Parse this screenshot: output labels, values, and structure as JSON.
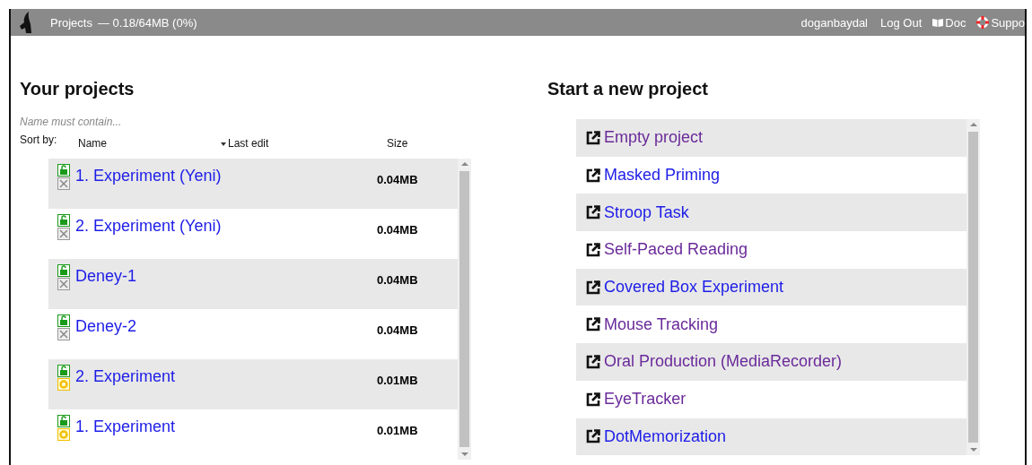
{
  "header": {
    "title": "Projects",
    "usage": "— 0.18/64MB (0%)",
    "user": "doganbaydal",
    "logout": "Log Out",
    "doc": "Doc",
    "support": "Suppo"
  },
  "projects": {
    "heading": "Your projects",
    "filter": {
      "placeholder": "Name must contain..."
    },
    "sort": {
      "label": "Sort by:",
      "columns": [
        {
          "label": "Name",
          "selected": false
        },
        {
          "label": "Last edit",
          "selected": true
        },
        {
          "label": "Size",
          "selected": false
        }
      ]
    },
    "rows": [
      {
        "name": "1. Experiment (Yeni)",
        "size": "0.04MB",
        "kind": "tools"
      },
      {
        "name": "2. Experiment (Yeni)",
        "size": "0.04MB",
        "kind": "tools"
      },
      {
        "name": "Deney-1",
        "size": "0.04MB",
        "kind": "tools"
      },
      {
        "name": "Deney-2",
        "size": "0.04MB",
        "kind": "tools"
      },
      {
        "name": "2. Experiment",
        "size": "0.01MB",
        "kind": "gear"
      },
      {
        "name": "1. Experiment",
        "size": "0.01MB",
        "kind": "gear"
      }
    ]
  },
  "new_project": {
    "heading": "Start a new project",
    "templates": [
      {
        "label": "Empty project",
        "visited": true
      },
      {
        "label": "Masked Priming",
        "visited": false
      },
      {
        "label": "Stroop Task",
        "visited": false
      },
      {
        "label": "Self-Paced Reading",
        "visited": true
      },
      {
        "label": "Covered Box Experiment",
        "visited": false
      },
      {
        "label": "Mouse Tracking",
        "visited": true
      },
      {
        "label": "Oral Production (MediaRecorder)",
        "visited": true
      },
      {
        "label": "EyeTracker",
        "visited": true
      },
      {
        "label": "DotMemorization",
        "visited": false
      }
    ]
  }
}
